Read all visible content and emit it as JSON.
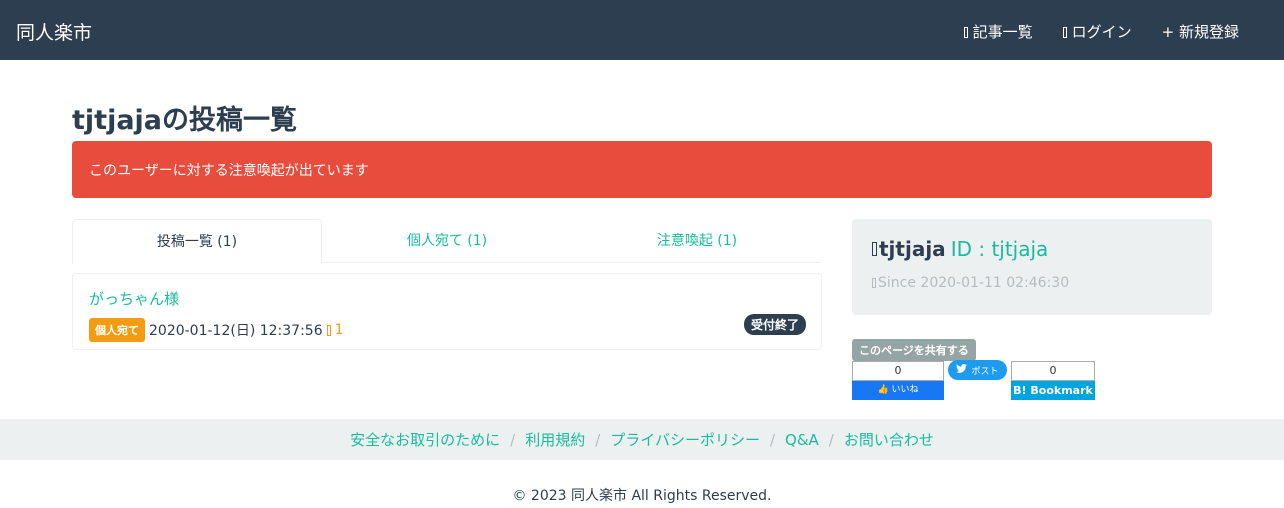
{
  "navbar": {
    "brand": "同人楽市",
    "links": [
      "記事一覧",
      "ログイン",
      "+ 新規登録"
    ]
  },
  "page_title": "tjtjajaの投稿一覧",
  "alert_text": "このユーザーに対する注意喚起が出ています",
  "tabs": [
    {
      "label": "投稿一覧 (1)"
    },
    {
      "label": "個人宛て (1)"
    },
    {
      "label": "注意喚起 (1)"
    }
  ],
  "posts": [
    {
      "title": "がっちゃん様",
      "type_badge": "個人宛て",
      "date": "2020-01-12(日) 12:37:56",
      "likes": "1",
      "status": "受付終了"
    }
  ],
  "profile": {
    "name": "tjtjaja",
    "id": "ID : tjtjaja",
    "since": "Since 2020-01-11 02:46:30"
  },
  "share": {
    "label": "このページを共有する",
    "fb_count": "0",
    "fb_label": "いいね",
    "tw_label": "ポスト",
    "hb_count": "0",
    "hb_label": "B! Bookmark"
  },
  "footer": {
    "links": [
      "安全なお取引のために",
      "利用規約",
      "プライバシーポリシー",
      "Q&A",
      "お問い合わせ"
    ],
    "copyright": "© 2023 同人楽市 All Rights Reserved."
  },
  "colors": {
    "navbar": "#2c3e50",
    "accent": "#18bc9c",
    "danger": "#e74c3c",
    "warning": "#f39c12",
    "light": "#ecf0f1"
  }
}
